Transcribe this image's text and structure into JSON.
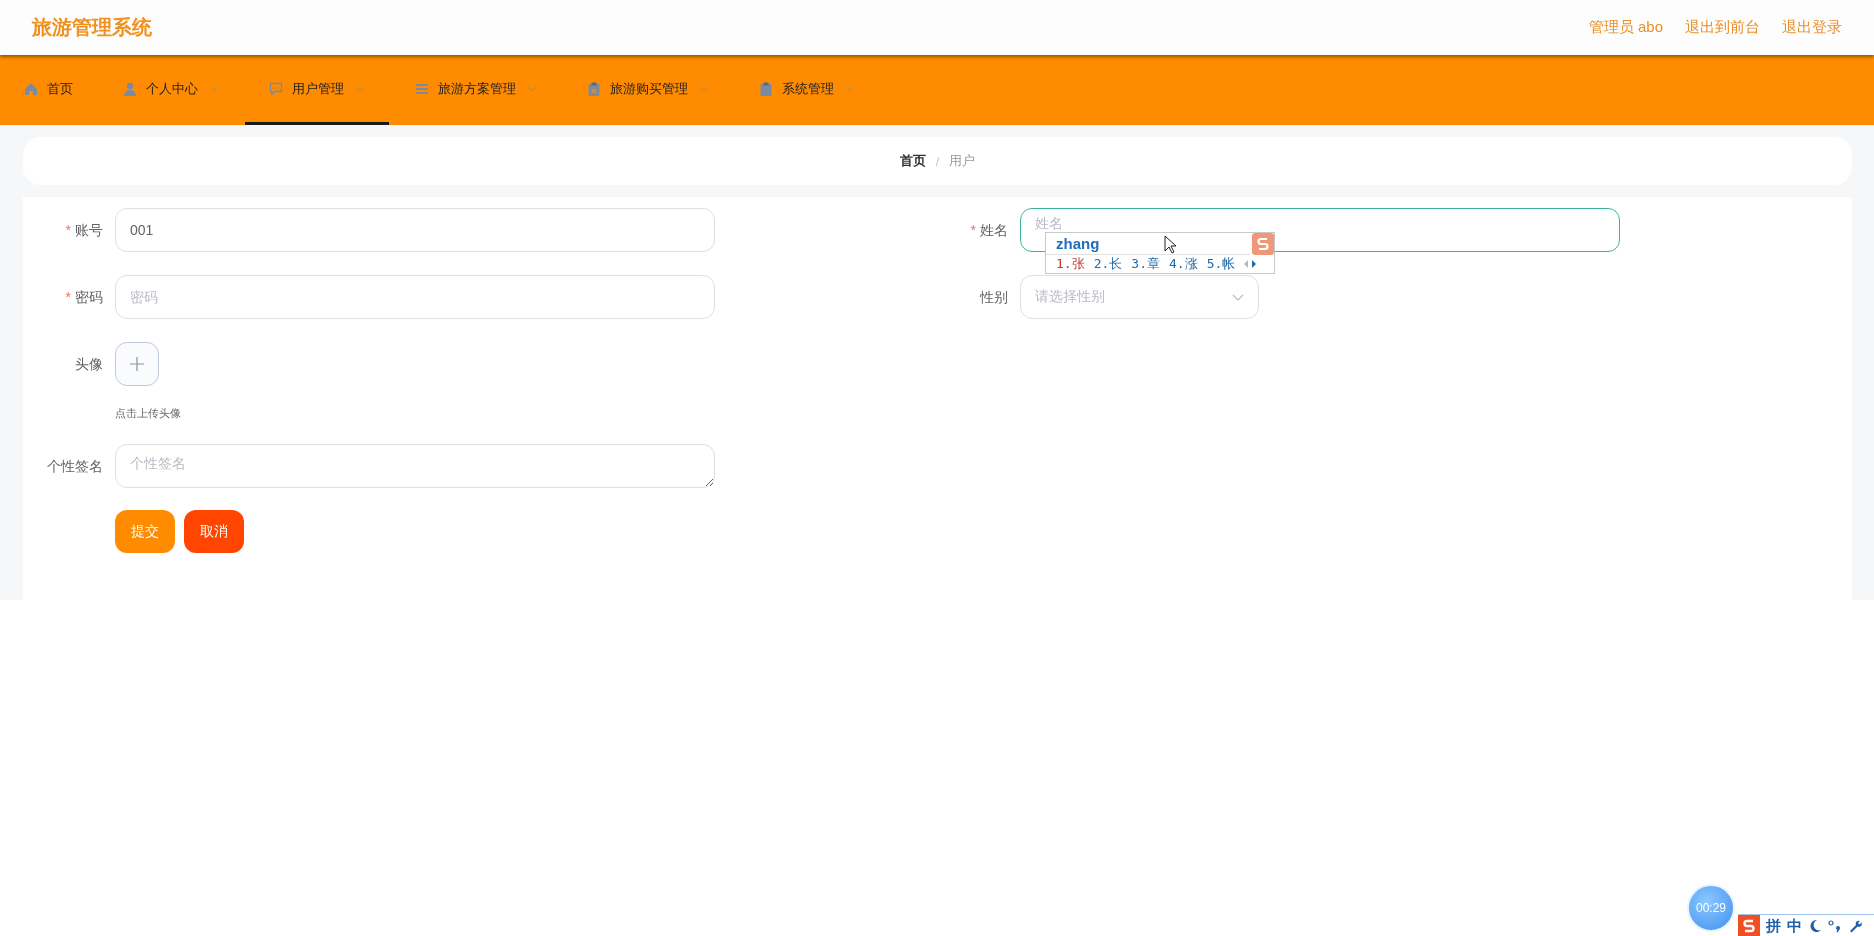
{
  "header": {
    "title": "旅游管理系统",
    "links": [
      "管理员 abo",
      "退出到前台",
      "退出登录"
    ]
  },
  "nav": [
    {
      "label": "首页",
      "has_caret": false,
      "selected": false
    },
    {
      "label": "个人中心",
      "has_caret": true,
      "selected": false
    },
    {
      "label": "用户管理",
      "has_caret": true,
      "selected": true
    },
    {
      "label": "旅游方案管理",
      "has_caret": true,
      "selected": false
    },
    {
      "label": "旅游购买管理",
      "has_caret": true,
      "selected": false
    },
    {
      "label": "系统管理",
      "has_caret": true,
      "selected": false
    }
  ],
  "breadcrumb": {
    "items": [
      "首页",
      "用户"
    ],
    "separator": "/"
  },
  "form": {
    "required_mark": "*",
    "left_fields": [
      {
        "kind": "input",
        "label": "账号",
        "required": true,
        "value": "001",
        "focused": false
      },
      {
        "kind": "input",
        "label": "密码",
        "required": true,
        "placeholder": "密码",
        "focused": false
      },
      {
        "kind": "upload",
        "label": "头像",
        "required": false,
        "hint": "点击上传头像"
      },
      {
        "kind": "textarea",
        "label": "个性签名",
        "required": false,
        "placeholder": "个性签名",
        "focused": false
      }
    ],
    "right_fields": [
      {
        "kind": "input",
        "label": "姓名",
        "required": true,
        "placeholder": "姓名",
        "focused": true
      },
      {
        "kind": "select",
        "label": "性别",
        "required": false,
        "placeholder": "请选择性别",
        "focused": false
      }
    ],
    "buttons": [
      {
        "label": "提交",
        "kind": "primary"
      },
      {
        "label": "取消",
        "kind": "danger"
      }
    ]
  },
  "ime_popup": {
    "composition": "zhang",
    "candidates": [
      {
        "label": "1.张",
        "selected": true
      },
      {
        "label": "2.长",
        "selected": false
      },
      {
        "label": "3.章",
        "selected": false
      },
      {
        "label": "4.涨",
        "selected": false
      },
      {
        "label": "5.帐",
        "selected": false
      }
    ]
  },
  "timer": "00:29",
  "ime_status": {
    "items": [
      "拼",
      "中"
    ]
  }
}
